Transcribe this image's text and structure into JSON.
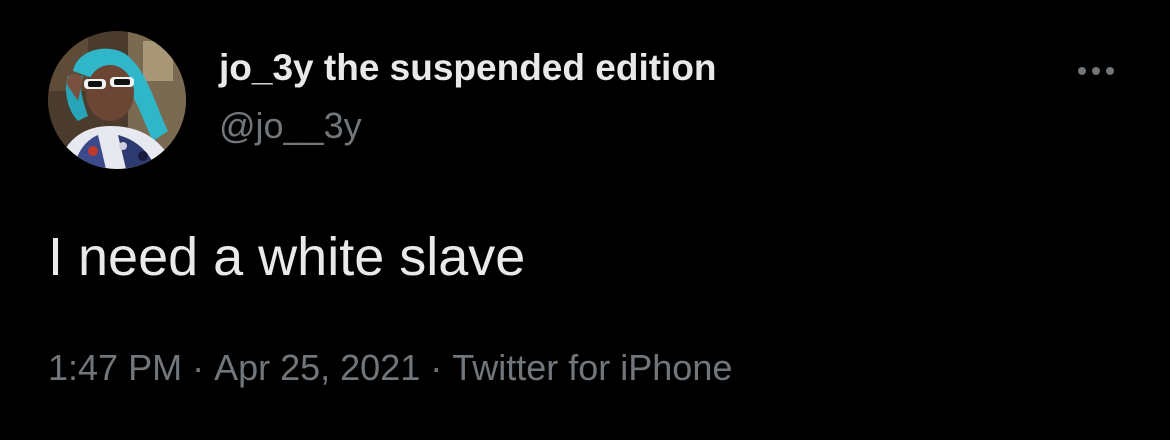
{
  "tweet": {
    "author": {
      "display_name": "jo_3y the suspended edition",
      "handle": "@jo__3y",
      "avatar": "profile-photo"
    },
    "text": "I need a white slave",
    "time": "1:47 PM",
    "separator": "·",
    "date": "Apr 25, 2021",
    "source": "Twitter for iPhone",
    "more_icon": "more-horizontal-icon"
  },
  "colors": {
    "background": "#000000",
    "primary_text": "#e7e9ea",
    "secondary_text": "#71767b"
  }
}
